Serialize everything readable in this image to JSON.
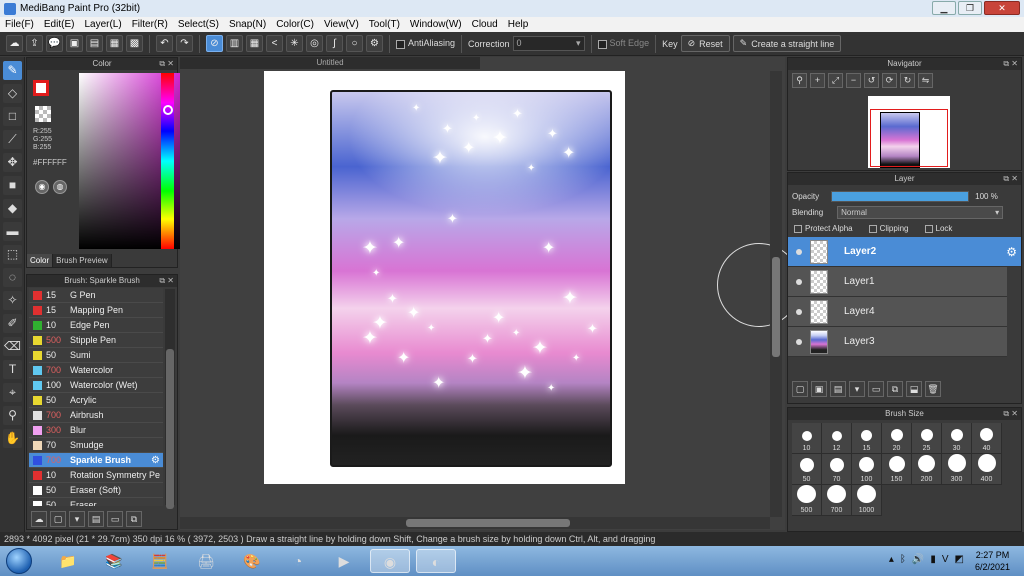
{
  "window": {
    "title": "MediBang Paint Pro (32bit)"
  },
  "menu": [
    "File(F)",
    "Edit(E)",
    "Layer(L)",
    "Filter(R)",
    "Select(S)",
    "Snap(N)",
    "Color(C)",
    "View(V)",
    "Tool(T)",
    "Window(W)",
    "Cloud",
    "Help"
  ],
  "toolbar": {
    "antialiasing_label": "AntiAliasing",
    "correction_label": "Correction",
    "correction_value": "0",
    "soft_edge_label": "Soft Edge",
    "key_label": "Key",
    "reset_label": "Reset",
    "straight_line_label": "Create a straight line"
  },
  "color_panel": {
    "title": "Color",
    "rgb": "R:255\nG:255\nB:255",
    "hex": "#FFFFFF",
    "tab_color": "Color",
    "tab_brush_preview": "Brush Preview"
  },
  "brush_panel": {
    "title": "Brush: Sparkle Brush",
    "items": [
      {
        "size": "15",
        "name": "G Pen",
        "color": "#e03030",
        "red": false
      },
      {
        "size": "15",
        "name": "Mapping Pen",
        "color": "#e03030",
        "red": false
      },
      {
        "size": "10",
        "name": "Edge Pen",
        "color": "#30b030",
        "red": false
      },
      {
        "size": "500",
        "name": "Stipple Pen",
        "color": "#e8d830",
        "red": true
      },
      {
        "size": "50",
        "name": "Sumi",
        "color": "#e8d830",
        "red": false
      },
      {
        "size": "700",
        "name": "Watercolor",
        "color": "#60c8f0",
        "red": true
      },
      {
        "size": "100",
        "name": "Watercolor (Wet)",
        "color": "#60c8f0",
        "red": false
      },
      {
        "size": "50",
        "name": "Acrylic",
        "color": "#e8d830",
        "red": false
      },
      {
        "size": "700",
        "name": "Airbrush",
        "color": "#e0e0e0",
        "red": true
      },
      {
        "size": "300",
        "name": "Blur",
        "color": "#f0a0f0",
        "red": true
      },
      {
        "size": "70",
        "name": "Smudge",
        "color": "#f0d8b8",
        "red": false
      },
      {
        "size": "700",
        "name": "Sparkle Brush",
        "color": "#3050e0",
        "red": true,
        "selected": true
      },
      {
        "size": "10",
        "name": "Rotation Symmetry Pe",
        "color": "#e03030",
        "red": false
      },
      {
        "size": "50",
        "name": "Eraser (Soft)",
        "color": "#ffffff",
        "red": false
      },
      {
        "size": "50",
        "name": "Eraser",
        "color": "#ffffff",
        "red": false
      }
    ]
  },
  "canvas": {
    "tab_title": "Untitled"
  },
  "navigator": {
    "title": "Navigator"
  },
  "layer_panel": {
    "title": "Layer",
    "opacity_label": "Opacity",
    "opacity_value": "100 %",
    "blending_label": "Blending",
    "blending_value": "Normal",
    "protect_alpha": "Protect Alpha",
    "clipping": "Clipping",
    "lock": "Lock",
    "layers": [
      {
        "name": "Layer2",
        "selected": true,
        "art": false
      },
      {
        "name": "Layer1",
        "selected": false,
        "art": false
      },
      {
        "name": "Layer4",
        "selected": false,
        "art": false
      },
      {
        "name": "Layer3",
        "selected": false,
        "art": true
      }
    ]
  },
  "brush_size_panel": {
    "title": "Brush Size",
    "sizes": [
      "10",
      "12",
      "15",
      "20",
      "25",
      "30",
      "40",
      "50",
      "70",
      "100",
      "150",
      "200",
      "300",
      "400",
      "500",
      "700",
      "1000"
    ]
  },
  "status": {
    "text": "2893 * 4092 pixel   (21 * 29.7cm)   350 dpi   16 %   ( 3972, 2503 )   Draw a straight line by holding down Shift, Change a brush size by holding down Ctrl, Alt, and dragging"
  },
  "taskbar": {
    "time": "2:27 PM",
    "date": "6/2/2021"
  }
}
